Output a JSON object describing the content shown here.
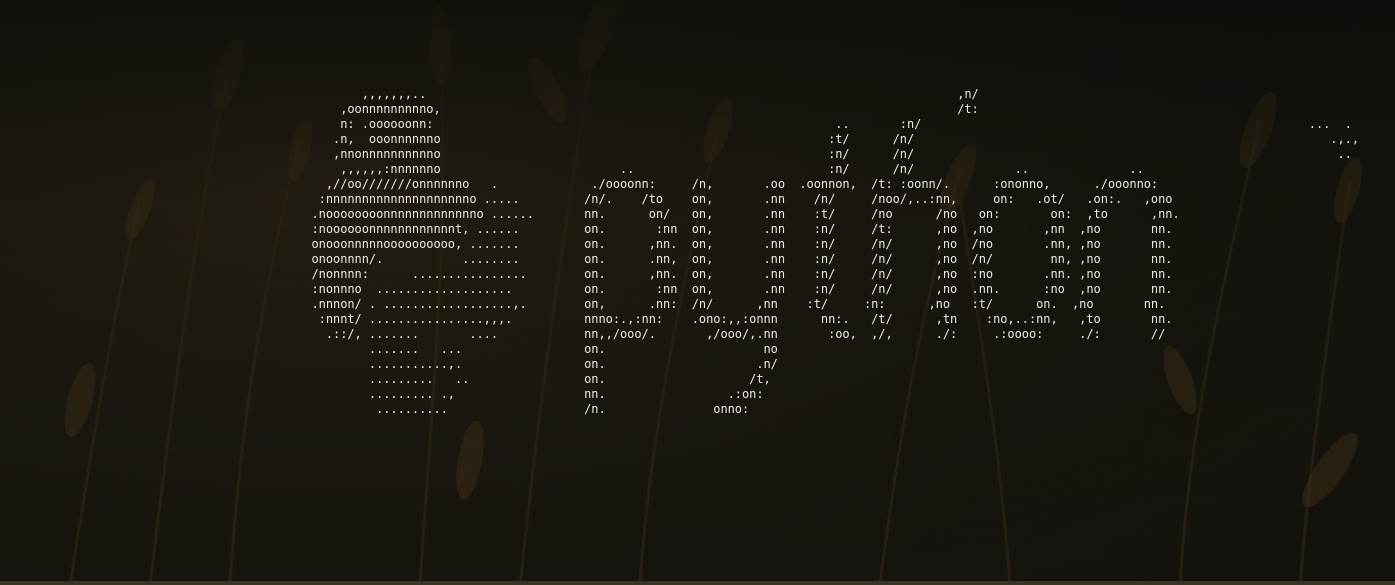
{
  "background": {
    "description_color": "#1d1a14",
    "icon": "wheat-field-wallpaper-icon"
  },
  "terminal": {
    "text_color": "#ece9e2",
    "ascii_banner": "                           ,,,,,,,..                                                                          ,n/\n                        ,oonnnnnnnnno,                                                                        /t:\n                        n: .oooooonn:                                                        ..       :n/                                                      ...  .\n                       .n,  ooonnnnnno                                                      :t/      /n/                                                          .,.,\n                       ,nnonnnnnnnnnno                                                      :n/      /n/                                                           ..\n                        ,,,,,,:nnnnnno                         ..                           :n/      /n/              ..              ..\n                      ,//oo///////onnnnnno   .             ./oooonn:     /n,       .oo  .oonnon,  /t: :oonn/.      :ononno,      ./ooonno:\n                     :nnnnnnnnnnnnnnnnnnnno .....         /n/.    /to    on,       .nn    /n/     /noo/,..:nn,     on:   .ot/   .on:.   ,ono\n                    .noooooooonnnnnnnnnnnnno ......       nn.      on/   on,       .nn    :t/     /no      /no   on:       on:  ,to      ,nn.\n                    :noooooonnnnnnnnnnnnt, ......         on.       :nn  on,       .nn    :n/     /t:      ,no  ,no       ,nn  ,no       nn.\n                    onooonnnnnoooooooooo, .......         on.      ,nn.  on,       .nn    :n/     /n/      ,no  /no       .nn, ,no       nn.\n                    onoonnnn/.           ........         on.      .nn,  on,       .nn    :n/     /n/      ,no  /n/        nn, ,no       nn.\n                    /nonnnn:      ................        on.      ,nn.  on,       .nn    :n/     /n/      ,no  :no       .nn. ,no       nn.\n                    :nonnno  ...................          on.       :nn  on,       .nn    :n/     /n/      ,no  .nn.      :no  ,no       nn.\n                    .nnnon/ . ..................,.        on,      .nn:  /n/      ,nn    :t/     :n:      ,no   :t/      on.  ,no       nn.\n                     :nnnt/ ................,,,.          nnno:.,:nn:    .ono:,,:onnn      nn:.   /t/      ,tn    :no,..:nn,   ,to       nn.\n                      .::/, .......       ....            nn,,/ooo/.       ,/ooo/,.nn       :oo,  ,/,      ./:     .:oooo:     ./:       //\n                            .......   ...                 on.                      no\n                            ...........,.                 on.                     .n/\n                            .........   ..                on.                    /t,\n                            ......... .,                  nn.                 .:on:\n                             ..........                   /n.               onno:"
  }
}
